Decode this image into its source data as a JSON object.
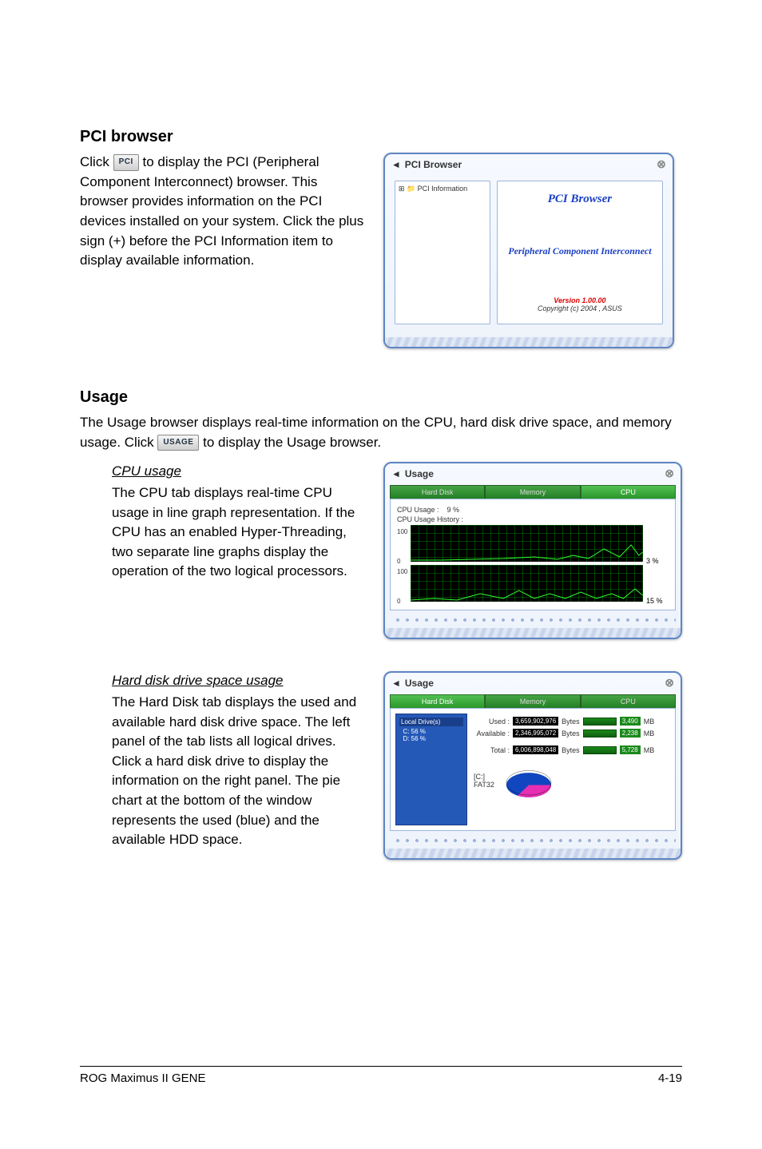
{
  "sections": {
    "pci": {
      "heading": "PCI browser",
      "para_pre": "Click ",
      "btn": "PCI",
      "para_post": " to display the PCI (Peripheral Component Interconnect) browser. This browser provides information on the PCI devices installed on your system. Click the plus sign (+) before the PCI Information item to display available information."
    },
    "usage": {
      "heading": "Usage",
      "intro_pre": "The Usage browser displays real-time information on the CPU, hard disk drive space, and memory usage. Click ",
      "btn": "USAGE",
      "intro_post": " to display the Usage browser.",
      "cpu": {
        "subhead": "CPU usage",
        "text": "The CPU tab displays real-time CPU usage in line graph representation. If the CPU has an enabled Hyper-Threading, two separate line graphs display the operation of the two logical processors."
      },
      "hdd": {
        "subhead": "Hard disk drive space usage",
        "text": "The Hard Disk tab displays the used and available hard disk drive space. The left panel of the tab lists all logical drives. Click a hard disk drive to display the information on the right panel. The pie chart at the bottom of the window represents the used (blue) and the available HDD space."
      }
    }
  },
  "thumb_pci": {
    "window_title": "PCI Browser",
    "tree_item": "PCI Information",
    "big": "PCI Browser",
    "mid": "Peripheral Component Interconnect",
    "ver": "Version 1.00.00",
    "copy": "Copyright (c) 2004 , ASUS"
  },
  "thumb_cpu": {
    "window_title": "Usage",
    "tab1": "Hard Disk",
    "tab2": "Memory",
    "tab3": "CPU",
    "usage_label": "CPU Usage :",
    "usage_val": "9  %",
    "history_label": "CPU Usage History :",
    "y100": "100",
    "y0": "0",
    "pct1": "3 %",
    "pct2": "15 %"
  },
  "thumb_hdd": {
    "window_title": "Usage",
    "tab1": "Hard Disk",
    "tab2": "Memory",
    "tab3": "CPU",
    "tree_root": "Local Drive(s)",
    "tree_c": "C: 56 %",
    "tree_d": "D: 56 %",
    "used_l": "Used :",
    "used_bytes": "3,659,902,976",
    "bytes": "Bytes",
    "used_mb": "3,490",
    "avail_l": "Available :",
    "avail_bytes": "2,346,995,072",
    "avail_mb": "2,238",
    "total_l": "Total :",
    "total_bytes": "6,006,898,048",
    "total_mb": "5,728",
    "mb": "MB",
    "drive": "[C:]",
    "fs": "FAT32"
  },
  "footer": {
    "left": "ROG Maximus II GENE",
    "right": "4-19"
  }
}
